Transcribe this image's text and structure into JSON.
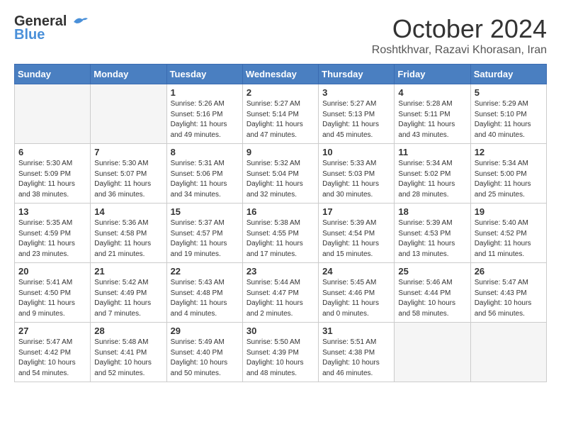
{
  "header": {
    "logo_line1": "General",
    "logo_line2": "Blue",
    "month": "October 2024",
    "location": "Roshtkhvar, Razavi Khorasan, Iran"
  },
  "weekdays": [
    "Sunday",
    "Monday",
    "Tuesday",
    "Wednesday",
    "Thursday",
    "Friday",
    "Saturday"
  ],
  "weeks": [
    [
      {
        "day": "",
        "empty": true
      },
      {
        "day": "",
        "empty": true
      },
      {
        "day": "1",
        "sunrise": "5:26 AM",
        "sunset": "5:16 PM",
        "daylight": "11 hours and 49 minutes."
      },
      {
        "day": "2",
        "sunrise": "5:27 AM",
        "sunset": "5:14 PM",
        "daylight": "11 hours and 47 minutes."
      },
      {
        "day": "3",
        "sunrise": "5:27 AM",
        "sunset": "5:13 PM",
        "daylight": "11 hours and 45 minutes."
      },
      {
        "day": "4",
        "sunrise": "5:28 AM",
        "sunset": "5:11 PM",
        "daylight": "11 hours and 43 minutes."
      },
      {
        "day": "5",
        "sunrise": "5:29 AM",
        "sunset": "5:10 PM",
        "daylight": "11 hours and 40 minutes."
      }
    ],
    [
      {
        "day": "6",
        "sunrise": "5:30 AM",
        "sunset": "5:09 PM",
        "daylight": "11 hours and 38 minutes."
      },
      {
        "day": "7",
        "sunrise": "5:30 AM",
        "sunset": "5:07 PM",
        "daylight": "11 hours and 36 minutes."
      },
      {
        "day": "8",
        "sunrise": "5:31 AM",
        "sunset": "5:06 PM",
        "daylight": "11 hours and 34 minutes."
      },
      {
        "day": "9",
        "sunrise": "5:32 AM",
        "sunset": "5:04 PM",
        "daylight": "11 hours and 32 minutes."
      },
      {
        "day": "10",
        "sunrise": "5:33 AM",
        "sunset": "5:03 PM",
        "daylight": "11 hours and 30 minutes."
      },
      {
        "day": "11",
        "sunrise": "5:34 AM",
        "sunset": "5:02 PM",
        "daylight": "11 hours and 28 minutes."
      },
      {
        "day": "12",
        "sunrise": "5:34 AM",
        "sunset": "5:00 PM",
        "daylight": "11 hours and 25 minutes."
      }
    ],
    [
      {
        "day": "13",
        "sunrise": "5:35 AM",
        "sunset": "4:59 PM",
        "daylight": "11 hours and 23 minutes."
      },
      {
        "day": "14",
        "sunrise": "5:36 AM",
        "sunset": "4:58 PM",
        "daylight": "11 hours and 21 minutes."
      },
      {
        "day": "15",
        "sunrise": "5:37 AM",
        "sunset": "4:57 PM",
        "daylight": "11 hours and 19 minutes."
      },
      {
        "day": "16",
        "sunrise": "5:38 AM",
        "sunset": "4:55 PM",
        "daylight": "11 hours and 17 minutes."
      },
      {
        "day": "17",
        "sunrise": "5:39 AM",
        "sunset": "4:54 PM",
        "daylight": "11 hours and 15 minutes."
      },
      {
        "day": "18",
        "sunrise": "5:39 AM",
        "sunset": "4:53 PM",
        "daylight": "11 hours and 13 minutes."
      },
      {
        "day": "19",
        "sunrise": "5:40 AM",
        "sunset": "4:52 PM",
        "daylight": "11 hours and 11 minutes."
      }
    ],
    [
      {
        "day": "20",
        "sunrise": "5:41 AM",
        "sunset": "4:50 PM",
        "daylight": "11 hours and 9 minutes."
      },
      {
        "day": "21",
        "sunrise": "5:42 AM",
        "sunset": "4:49 PM",
        "daylight": "11 hours and 7 minutes."
      },
      {
        "day": "22",
        "sunrise": "5:43 AM",
        "sunset": "4:48 PM",
        "daylight": "11 hours and 4 minutes."
      },
      {
        "day": "23",
        "sunrise": "5:44 AM",
        "sunset": "4:47 PM",
        "daylight": "11 hours and 2 minutes."
      },
      {
        "day": "24",
        "sunrise": "5:45 AM",
        "sunset": "4:46 PM",
        "daylight": "11 hours and 0 minutes."
      },
      {
        "day": "25",
        "sunrise": "5:46 AM",
        "sunset": "4:44 PM",
        "daylight": "10 hours and 58 minutes."
      },
      {
        "day": "26",
        "sunrise": "5:47 AM",
        "sunset": "4:43 PM",
        "daylight": "10 hours and 56 minutes."
      }
    ],
    [
      {
        "day": "27",
        "sunrise": "5:47 AM",
        "sunset": "4:42 PM",
        "daylight": "10 hours and 54 minutes."
      },
      {
        "day": "28",
        "sunrise": "5:48 AM",
        "sunset": "4:41 PM",
        "daylight": "10 hours and 52 minutes."
      },
      {
        "day": "29",
        "sunrise": "5:49 AM",
        "sunset": "4:40 PM",
        "daylight": "10 hours and 50 minutes."
      },
      {
        "day": "30",
        "sunrise": "5:50 AM",
        "sunset": "4:39 PM",
        "daylight": "10 hours and 48 minutes."
      },
      {
        "day": "31",
        "sunrise": "5:51 AM",
        "sunset": "4:38 PM",
        "daylight": "10 hours and 46 minutes."
      },
      {
        "day": "",
        "empty": true
      },
      {
        "day": "",
        "empty": true
      }
    ]
  ]
}
